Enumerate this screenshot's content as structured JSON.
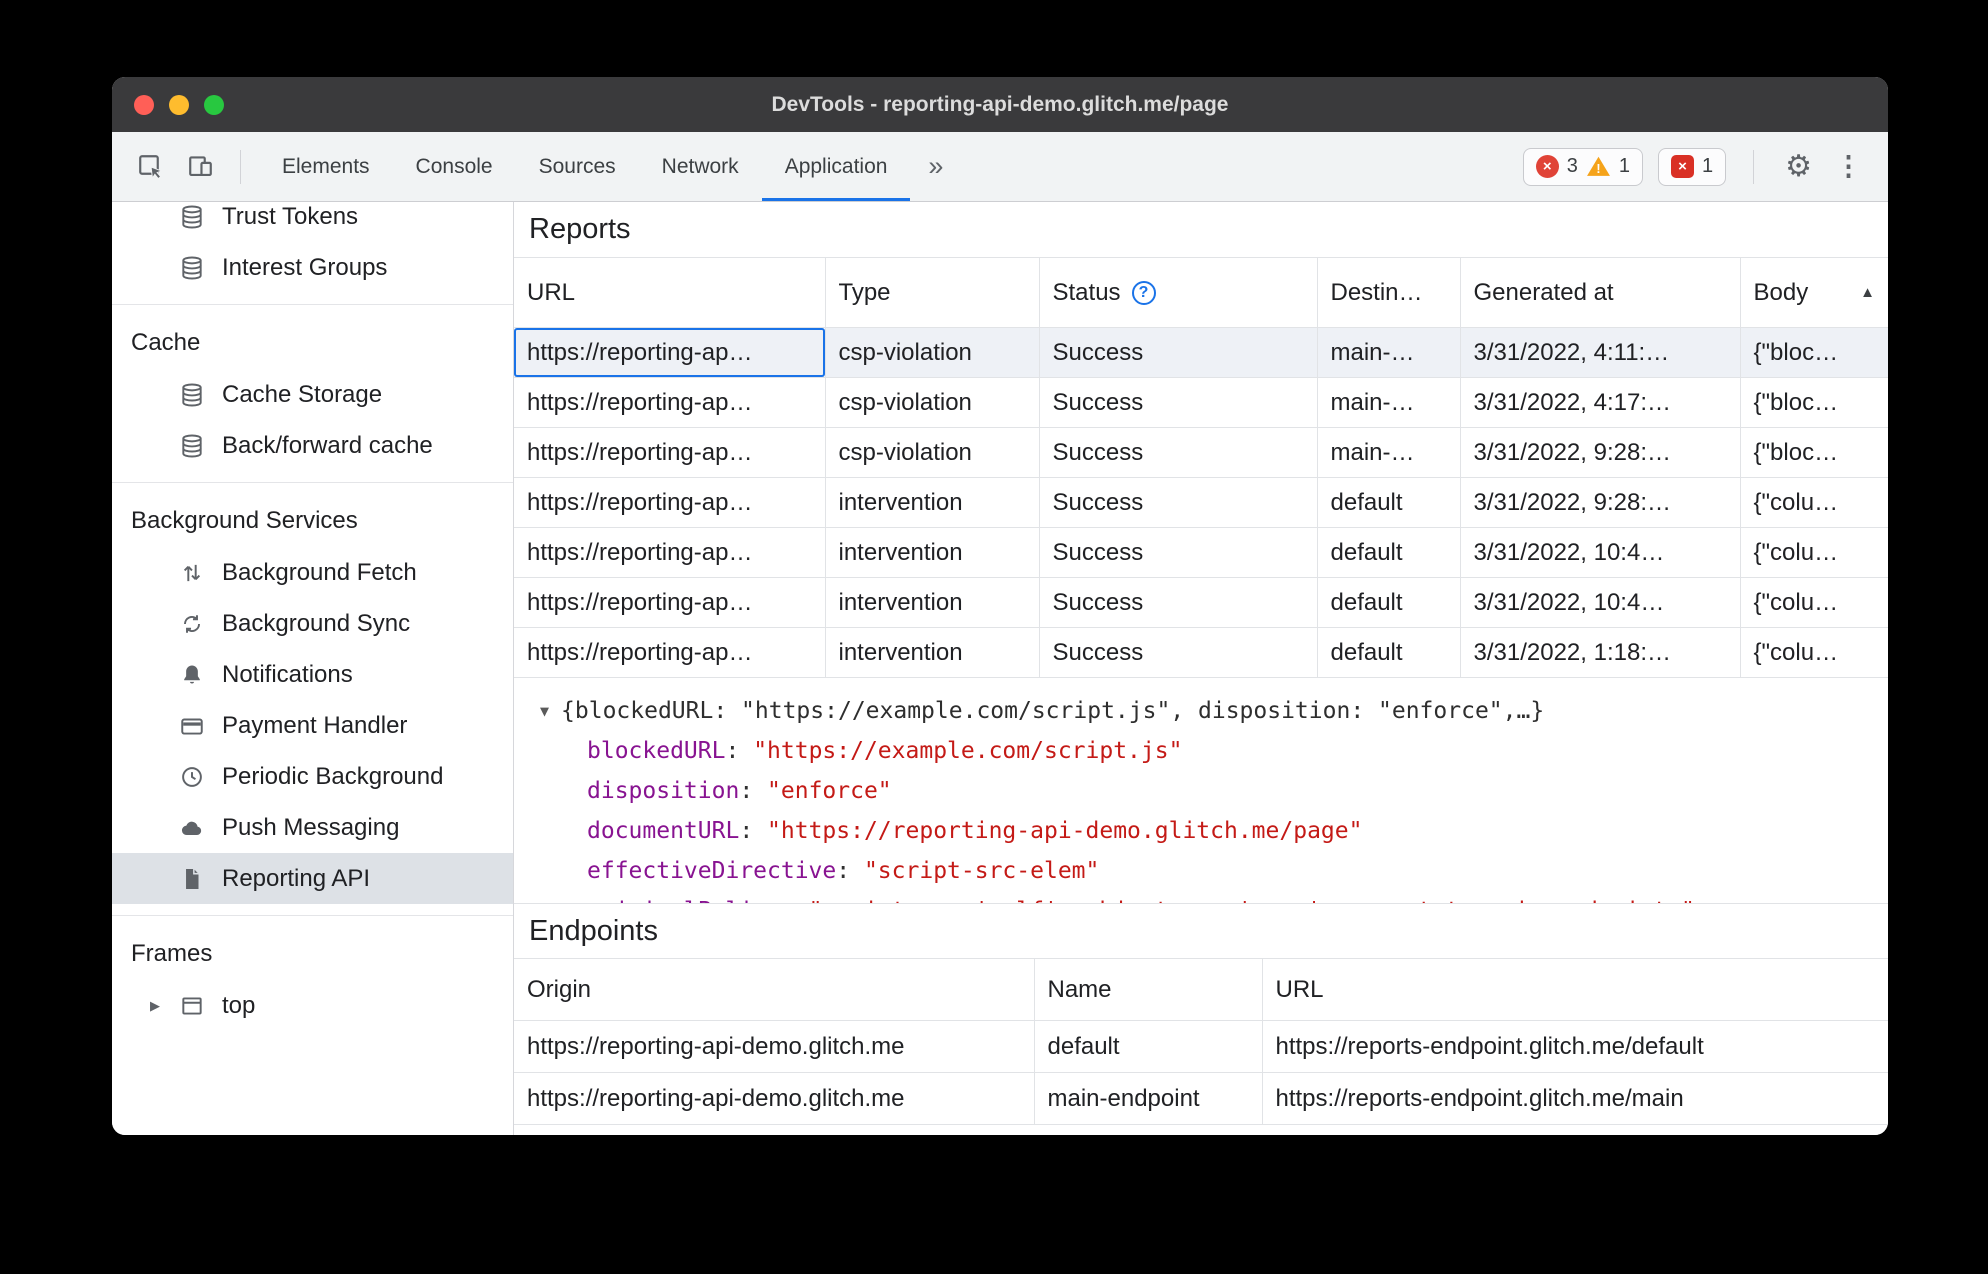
{
  "window": {
    "title": "DevTools - reporting-api-demo.glitch.me/page"
  },
  "icons": {
    "more_tabs": "»",
    "gear": "⚙",
    "kebab": "⋮",
    "cross": "×",
    "help": "?",
    "sort_ascending": "▲",
    "expanded_triangle": "▼",
    "collapsed_triangle": "▶"
  },
  "toolbar": {
    "tabs": [
      {
        "label": "Elements"
      },
      {
        "label": "Console"
      },
      {
        "label": "Sources"
      },
      {
        "label": "Network"
      },
      {
        "label": "Application",
        "selected": true
      }
    ],
    "error_count": "3",
    "warning_count": "1",
    "issue_count": "1"
  },
  "sidebar": {
    "section_headers": [
      "Cache",
      "Background Services",
      "Frames"
    ],
    "items": [
      {
        "label": "Trust Tokens",
        "icon": "database-icon"
      },
      {
        "label": "Interest Groups",
        "icon": "database-icon"
      },
      {
        "label": "Cache Storage",
        "icon": "database-icon"
      },
      {
        "label": "Back/forward cache",
        "icon": "database-icon"
      },
      {
        "label": "Background Fetch",
        "icon": "fetch-arrows-icon"
      },
      {
        "label": "Background Sync",
        "icon": "sync-icon"
      },
      {
        "label": "Notifications",
        "icon": "bell-icon"
      },
      {
        "label": "Payment Handler",
        "icon": "payment-card-icon"
      },
      {
        "label": "Periodic Background",
        "icon": "clock-icon"
      },
      {
        "label": "Push Messaging",
        "icon": "cloud-icon"
      },
      {
        "label": "Reporting API",
        "icon": "document-icon",
        "selected": true
      },
      {
        "label": "top",
        "icon": "frame-icon"
      }
    ]
  },
  "reports": {
    "title": "Reports",
    "columns": [
      "URL",
      "Type",
      "Status",
      "Destin…",
      "Generated at",
      "Body"
    ],
    "rows": [
      {
        "url": "https://reporting-ap…",
        "type": "csp-violation",
        "status": "Success",
        "destination": "main-…",
        "generated_at": "3/31/2022, 4:11:…",
        "body": "{\"bloc…"
      },
      {
        "url": "https://reporting-ap…",
        "type": "csp-violation",
        "status": "Success",
        "destination": "main-…",
        "generated_at": "3/31/2022, 4:17:…",
        "body": "{\"bloc…"
      },
      {
        "url": "https://reporting-ap…",
        "type": "csp-violation",
        "status": "Success",
        "destination": "main-…",
        "generated_at": "3/31/2022, 9:28:…",
        "body": "{\"bloc…"
      },
      {
        "url": "https://reporting-ap…",
        "type": "intervention",
        "status": "Success",
        "destination": "default",
        "generated_at": "3/31/2022, 9:28:…",
        "body": "{\"colu…"
      },
      {
        "url": "https://reporting-ap…",
        "type": "intervention",
        "status": "Success",
        "destination": "default",
        "generated_at": "3/31/2022, 10:4…",
        "body": "{\"colu…"
      },
      {
        "url": "https://reporting-ap…",
        "type": "intervention",
        "status": "Success",
        "destination": "default",
        "generated_at": "3/31/2022, 10:4…",
        "body": "{\"colu…"
      },
      {
        "url": "https://reporting-ap…",
        "type": "intervention",
        "status": "Success",
        "destination": "default",
        "generated_at": "3/31/2022, 1:18:…",
        "body": "{\"colu…"
      }
    ]
  },
  "report_preview": {
    "summary": "{blockedURL: \"https://example.com/script.js\", disposition: \"enforce\",…}",
    "properties": [
      {
        "name": "blockedURL",
        "value": "\"https://example.com/script.js\""
      },
      {
        "name": "disposition",
        "value": "\"enforce\""
      },
      {
        "name": "documentURL",
        "value": "\"https://reporting-api-demo.glitch.me/page\""
      },
      {
        "name": "effectiveDirective",
        "value": "\"script-src-elem\""
      }
    ],
    "clipped_property": {
      "name": "originalPolicy",
      "value": "\"script-src 'self'; object-src 'none'; report-to main-endpoint;\""
    }
  },
  "endpoints": {
    "title": "Endpoints",
    "columns": [
      "Origin",
      "Name",
      "URL"
    ],
    "rows": [
      {
        "origin": "https://reporting-api-demo.glitch.me",
        "name": "default",
        "url": "https://reports-endpoint.glitch.me/default"
      },
      {
        "origin": "https://reporting-api-demo.glitch.me",
        "name": "main-endpoint",
        "url": "https://reports-endpoint.glitch.me/main"
      }
    ]
  }
}
